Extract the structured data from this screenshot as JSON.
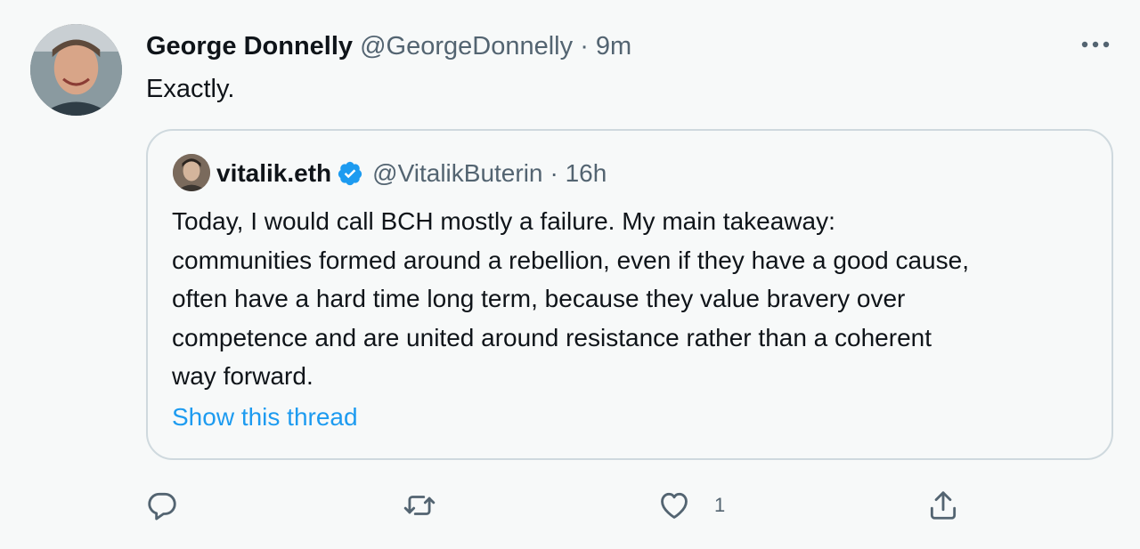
{
  "tweet": {
    "author_name": "George Donnelly",
    "author_handle": "@GeorgeDonnelly",
    "time": "· 9m",
    "text": "Exactly.",
    "more_icon": "more-horizontal-icon"
  },
  "quoted": {
    "author_name": "vitalik.eth",
    "author_handle": "@VitalikButerin",
    "time": "· 16h",
    "verified_icon": "verified-badge-icon",
    "text_lines": [
      "Today, I would call BCH mostly a failure. My main takeaway:",
      "communities formed around a rebellion, even if they have a good cause,",
      "often have a hard time long term, because they value bravery over",
      "competence and are united around resistance rather than a coherent",
      "way forward."
    ],
    "show_thread": "Show this thread"
  },
  "actions": {
    "reply_icon": "reply-icon",
    "retweet_icon": "retweet-icon",
    "like_icon": "like-heart-icon",
    "like_count": "1",
    "share_icon": "share-icon"
  },
  "colors": {
    "background": "#f7f9f9",
    "text": "#0f1419",
    "secondary": "#536471",
    "link": "#1d9bf0",
    "border": "#cfd9de"
  }
}
